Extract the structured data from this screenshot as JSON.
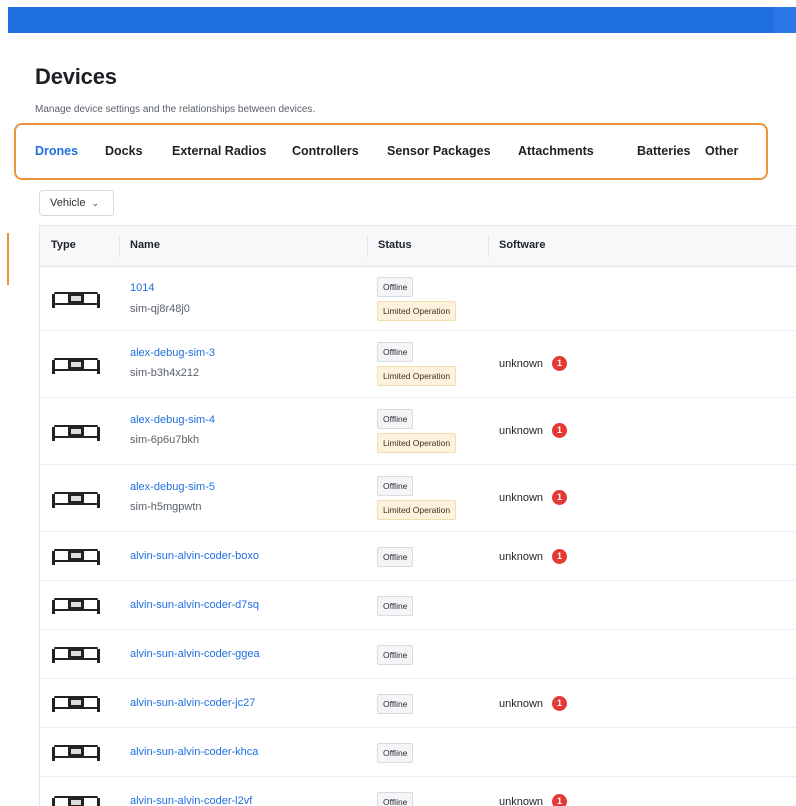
{
  "page": {
    "title": "Devices",
    "subtitle": "Manage device settings and the relationships between devices."
  },
  "tabs": [
    {
      "label": "Drones",
      "active": true
    },
    {
      "label": "Docks",
      "active": false
    },
    {
      "label": "External Radios",
      "active": false
    },
    {
      "label": "Controllers",
      "active": false
    },
    {
      "label": "Sensor Packages",
      "active": false
    },
    {
      "label": "Attachments",
      "active": false
    },
    {
      "label": "Batteries",
      "active": false
    },
    {
      "label": "Other",
      "active": false
    }
  ],
  "filter": {
    "label": "Vehicle",
    "icon": "chevron-down-icon"
  },
  "table": {
    "columns": {
      "type": "Type",
      "name": "Name",
      "status": "Status",
      "software": "Software"
    },
    "rows": [
      {
        "name": "1014",
        "serial": "sim-qj8r48j0",
        "statuses": [
          "Offline",
          "Limited Operation"
        ],
        "software": "",
        "alert_count": ""
      },
      {
        "name": "alex-debug-sim-3",
        "serial": "sim-b3h4x212",
        "statuses": [
          "Offline",
          "Limited Operation"
        ],
        "software": "unknown",
        "alert_count": "1"
      },
      {
        "name": "alex-debug-sim-4",
        "serial": "sim-6p6u7bkh",
        "statuses": [
          "Offline",
          "Limited Operation"
        ],
        "software": "unknown",
        "alert_count": "1"
      },
      {
        "name": "alex-debug-sim-5",
        "serial": "sim-h5mgpwtn",
        "statuses": [
          "Offline",
          "Limited Operation"
        ],
        "software": "unknown",
        "alert_count": "1"
      },
      {
        "name": "alvin-sun-alvin-coder-boxo",
        "serial": "",
        "statuses": [
          "Offline"
        ],
        "software": "unknown",
        "alert_count": "1"
      },
      {
        "name": "alvin-sun-alvin-coder-d7sq",
        "serial": "",
        "statuses": [
          "Offline"
        ],
        "software": "",
        "alert_count": ""
      },
      {
        "name": "alvin-sun-alvin-coder-ggea",
        "serial": "",
        "statuses": [
          "Offline"
        ],
        "software": "",
        "alert_count": ""
      },
      {
        "name": "alvin-sun-alvin-coder-jc27",
        "serial": "",
        "statuses": [
          "Offline"
        ],
        "software": "unknown",
        "alert_count": "1"
      },
      {
        "name": "alvin-sun-alvin-coder-khca",
        "serial": "",
        "statuses": [
          "Offline"
        ],
        "software": "",
        "alert_count": ""
      },
      {
        "name": "alvin-sun-alvin-coder-l2vf",
        "serial": "",
        "statuses": [
          "Offline"
        ],
        "software": "unknown",
        "alert_count": "1"
      }
    ]
  },
  "colors": {
    "accent": "#1f6fe0",
    "highlight": "#f0923a",
    "alert": "#e53935",
    "warning_badge": "#fdf3dd"
  },
  "icons": {
    "row_type": "drone-icon",
    "software_alert": "alert-badge-icon"
  }
}
